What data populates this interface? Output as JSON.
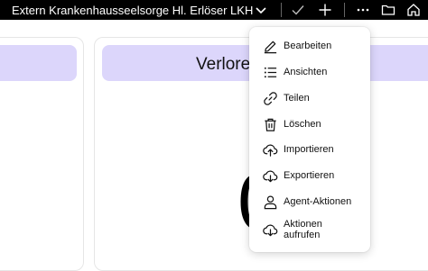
{
  "topbar": {
    "title": "Extern Krankenhausseelsorge Hl. Erlöser LKH",
    "background": "#000000",
    "icons": [
      "chevron-down-icon",
      "check-icon",
      "plus-icon",
      "more-icon",
      "folder-icon",
      "home-icon"
    ]
  },
  "cards": [
    {
      "title": ""
    },
    {
      "title": "Verlore",
      "glyph": "0"
    }
  ],
  "menu": {
    "items": [
      {
        "label": "Bearbeiten",
        "icon": "edit-icon"
      },
      {
        "label": "Ansichten",
        "icon": "list-icon"
      },
      {
        "label": "Teilen",
        "icon": "link-icon"
      },
      {
        "label": "Löschen",
        "icon": "trash-icon"
      },
      {
        "label": "Importieren",
        "icon": "cloud-upload-icon"
      },
      {
        "label": "Exportieren",
        "icon": "cloud-download-icon"
      },
      {
        "label": "Agent-Aktionen",
        "icon": "user-icon"
      },
      {
        "label": "Aktionen aufrufen",
        "icon": "cloud-download-icon"
      }
    ]
  },
  "colors": {
    "card_header": "#dcd6fb",
    "topbar": "#000000"
  }
}
